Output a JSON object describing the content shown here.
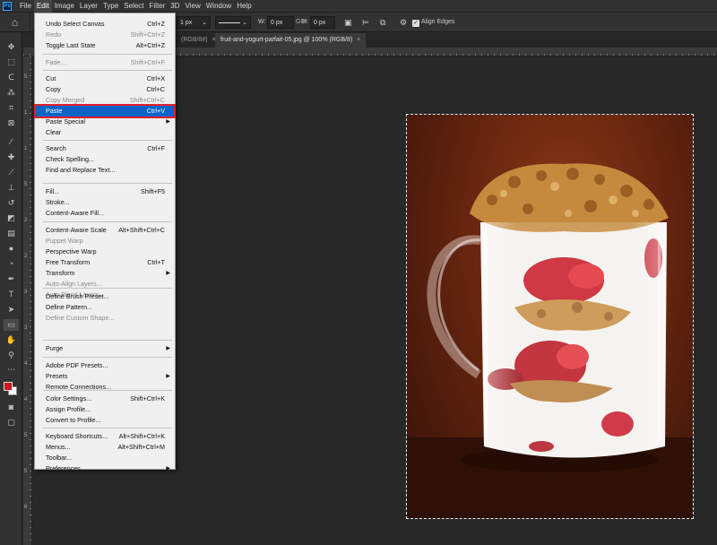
{
  "menubar": {
    "logo": "Ps",
    "items": [
      "File",
      "Edit",
      "Image",
      "Layer",
      "Type",
      "Select",
      "Filter",
      "3D",
      "View",
      "Window",
      "Help"
    ],
    "active_index": 1
  },
  "options_bar": {
    "stroke_width": "1 px",
    "w_label": "W:",
    "w_value": "0 px",
    "go_label": "GO",
    "h_label": "H:",
    "h_value": "0 px",
    "align_edges": "Align Edges"
  },
  "tabs": [
    {
      "label": "(RGB/8#)",
      "close": "×"
    },
    {
      "label": "fruit-and-yogurt-parfait-05.jpg @ 100% (RGB/8)",
      "close": "×"
    }
  ],
  "ruler_v_numbers": [
    "5",
    "1",
    "1",
    "5",
    "2",
    "2",
    "3",
    "3",
    "4",
    "4",
    "5",
    "5",
    "6"
  ],
  "edit_menu": {
    "items": [
      {
        "label": "Undo Select Canvas",
        "shortcut": "Ctrl+Z"
      },
      {
        "label": "Redo",
        "shortcut": "Shift+Ctrl+Z",
        "disabled": true
      },
      {
        "label": "Toggle Last State",
        "shortcut": "Alt+Ctrl+Z"
      },
      {
        "label": "Fade...",
        "shortcut": "Shift+Ctrl+F",
        "disabled": true
      },
      {
        "label": "Cut",
        "shortcut": "Ctrl+X"
      },
      {
        "label": "Copy",
        "shortcut": "Ctrl+C"
      },
      {
        "label": "Copy Merged",
        "shortcut": "Shift+Ctrl+C",
        "disabled": true
      },
      {
        "label": "Paste",
        "shortcut": "Ctrl+V",
        "highlighted": true
      },
      {
        "label": "Paste Special",
        "submenu": true
      },
      {
        "label": "Clear"
      },
      {
        "label": "Search",
        "shortcut": "Ctrl+F"
      },
      {
        "label": "Check Spelling..."
      },
      {
        "label": "Find and Replace Text..."
      },
      {
        "label": "Fill...",
        "shortcut": "Shift+F5"
      },
      {
        "label": "Stroke..."
      },
      {
        "label": "Content-Aware Fill..."
      },
      {
        "label": "Content-Aware Scale",
        "shortcut": "Alt+Shift+Ctrl+C"
      },
      {
        "label": "Puppet Warp",
        "disabled": true
      },
      {
        "label": "Perspective Warp"
      },
      {
        "label": "Free Transform",
        "shortcut": "Ctrl+T"
      },
      {
        "label": "Transform",
        "submenu": true
      },
      {
        "label": "Auto-Align Layers...",
        "disabled": true
      },
      {
        "label": "Auto-Blend Layers...",
        "disabled": true
      },
      {
        "label": "Define Brush Preset..."
      },
      {
        "label": "Define Pattern..."
      },
      {
        "label": "Define Custom Shape...",
        "disabled": true
      },
      {
        "label": "Purge",
        "submenu": true
      },
      {
        "label": "Adobe PDF Presets..."
      },
      {
        "label": "Presets",
        "submenu": true
      },
      {
        "label": "Remote Connections..."
      },
      {
        "label": "Color Settings...",
        "shortcut": "Shift+Ctrl+K"
      },
      {
        "label": "Assign Profile..."
      },
      {
        "label": "Convert to Profile..."
      },
      {
        "label": "Keyboard Shortcuts...",
        "shortcut": "Alt+Shift+Ctrl+K"
      },
      {
        "label": "Menus...",
        "shortcut": "Alt+Shift+Ctrl+M"
      },
      {
        "label": "Toolbar..."
      },
      {
        "label": "Preferences",
        "submenu": true
      }
    ]
  },
  "colors": {
    "foreground": "#c8191c",
    "background": "#ffffff",
    "highlight": "#0a64c8",
    "highlight_outline": "#e0202a"
  }
}
